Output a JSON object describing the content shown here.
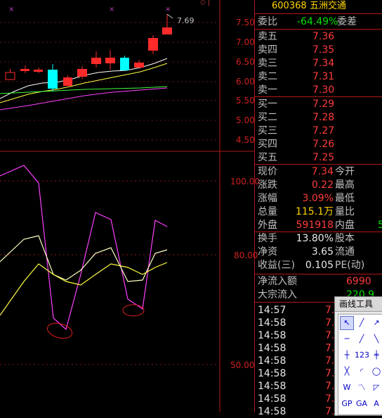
{
  "chart": {
    "top_marker": "◇ |",
    "price_axis": [
      "7.50",
      "7.00",
      "6.50",
      "6.00",
      "5.50",
      "5.00",
      "4.50"
    ],
    "high_label": "7.69",
    "ind_axis": [
      "100.00",
      "80.00",
      "50.00"
    ],
    "colors": {
      "up": "#ff2a2a",
      "down": "#00ffff",
      "ma1": "#ffffff",
      "ma2": "#ffff40",
      "ma3": "#40ff40",
      "ma4": "#ff40ff",
      "grid": "#8b1a1a",
      "axis": "#b01818"
    }
  },
  "quote": {
    "code": "600368",
    "name": "五洲交通",
    "weibi_label": "委比",
    "weibi_value": "-64.49%",
    "weicha_label": "委差",
    "asks": [
      {
        "label": "卖五",
        "price": "7.36"
      },
      {
        "label": "卖四",
        "price": "7.35"
      },
      {
        "label": "卖三",
        "price": "7.34"
      },
      {
        "label": "卖二",
        "price": "7.31"
      },
      {
        "label": "卖一",
        "price": "7.30"
      }
    ],
    "bids": [
      {
        "label": "买一",
        "price": "7.29"
      },
      {
        "label": "买二",
        "price": "7.28"
      },
      {
        "label": "买三",
        "price": "7.27"
      },
      {
        "label": "买四",
        "price": "7.26"
      },
      {
        "label": "买五",
        "price": "7.25"
      }
    ],
    "stats": [
      {
        "label": "现价",
        "value": "7.34",
        "label2": "今开"
      },
      {
        "label": "涨跌",
        "value": "0.22",
        "label2": "最高"
      },
      {
        "label": "涨幅",
        "value": "3.09%",
        "label2": "最低"
      },
      {
        "label": "总量",
        "value": "115.1万",
        "label2": "量比"
      },
      {
        "label": "外盘",
        "value": "591918",
        "label2": "内盘",
        "value2": "5"
      },
      {
        "label": "换手",
        "value": "13.80%",
        "label2": "股本"
      },
      {
        "label": "净资",
        "value": "3.65",
        "label2": "流通"
      },
      {
        "label": "收益(三)",
        "value": "0.105",
        "label2": "PE(动)"
      }
    ],
    "flow": [
      {
        "label": "净流入额",
        "value": "6990"
      },
      {
        "label": "大宗流入",
        "value": "220.9"
      }
    ],
    "ticks": [
      {
        "time": "14:57",
        "price": "7."
      },
      {
        "time": "14:58",
        "price": "7."
      },
      {
        "time": "14:58",
        "price": "7."
      },
      {
        "time": "14:58",
        "price": "7."
      },
      {
        "time": "14:58",
        "price": "7."
      },
      {
        "time": "14:58",
        "price": "7."
      },
      {
        "time": "14:58",
        "price": "7."
      },
      {
        "time": "14:58",
        "price": "7."
      },
      {
        "time": "14:58",
        "price": "7."
      }
    ]
  },
  "tool": {
    "title": "画线工具",
    "icons": [
      "pointer-icon",
      "line-icon",
      "ray-icon",
      "segment-icon",
      "arrow-icon",
      "cross-icon",
      "price-line-icon",
      "numbers-icon",
      "parallel-icon",
      "channel-icon",
      "arc-icon",
      "circle-icon",
      "wave-icon",
      "zigzag-icon",
      "fan-icon",
      "gp-icon",
      "ga-icon",
      "text-icon"
    ]
  }
}
